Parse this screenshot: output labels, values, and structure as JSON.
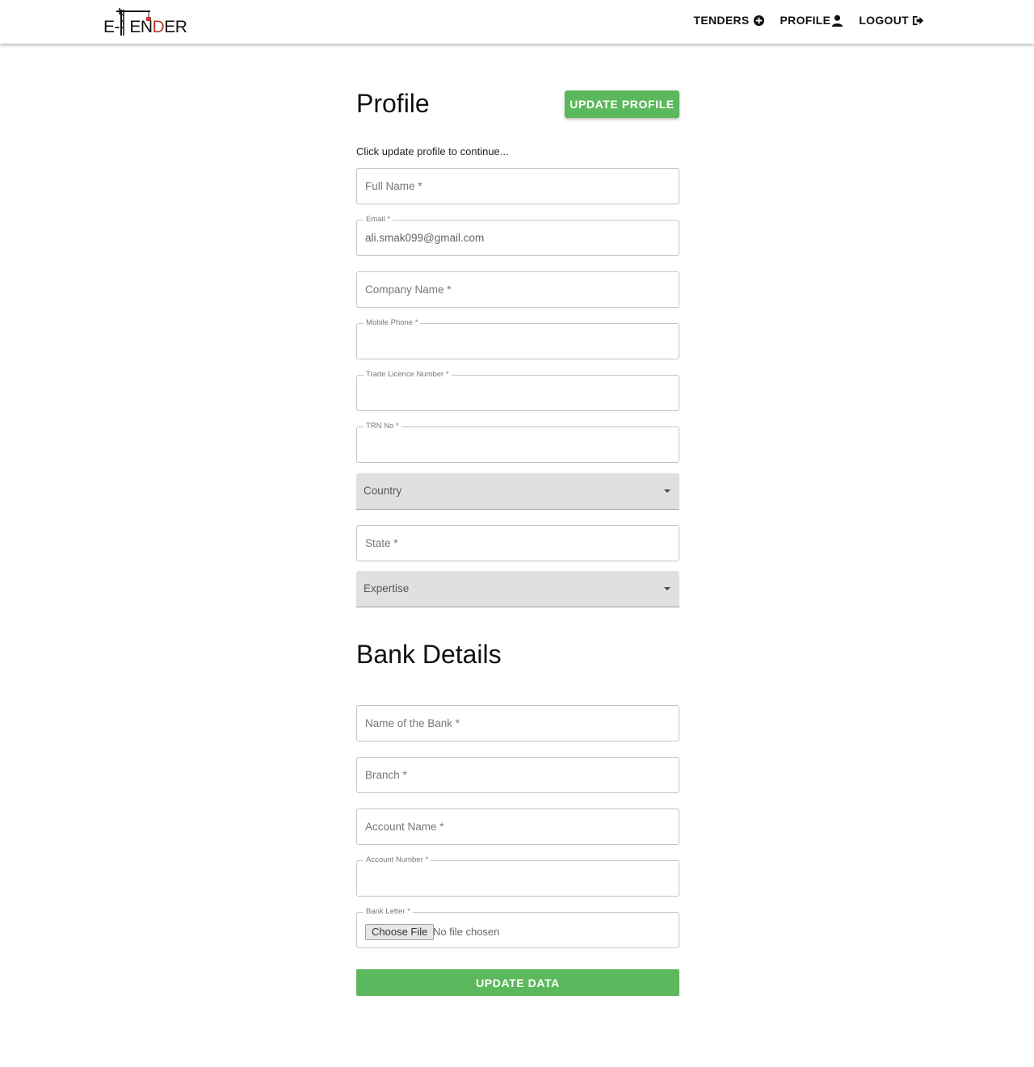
{
  "header": {
    "logo": {
      "prefix": "E-",
      "t": "T",
      "en": "EN",
      "d": "D",
      "er": "ER"
    },
    "nav": {
      "tenders": {
        "label": "TENDERS",
        "icon": "plus-circle-icon"
      },
      "profile": {
        "label": "PROFILE",
        "icon": "user-icon"
      },
      "logout": {
        "label": "LOGOUT",
        "icon": "sign-out-icon"
      }
    }
  },
  "profile": {
    "title": "Profile",
    "update_button": "UPDATE PROFILE",
    "subtitle": "Click update profile to continue...",
    "fields": {
      "full_name": {
        "placeholder": "Full Name *"
      },
      "email": {
        "label": "Email *",
        "value": "ali.smak099@gmail.com"
      },
      "company_name": {
        "placeholder": "Company Name *"
      },
      "mobile_phone": {
        "label": "Mobile Phone *"
      },
      "trade_licence": {
        "label": "Trade Licence Number *"
      },
      "trn_no": {
        "label": "TRN No *"
      },
      "country": {
        "placeholder": "Country"
      },
      "state": {
        "placeholder": "State *"
      },
      "expertise": {
        "placeholder": "Expertise"
      }
    }
  },
  "bank": {
    "title": "Bank Details",
    "fields": {
      "bank_name": {
        "placeholder": "Name of the Bank *"
      },
      "branch": {
        "placeholder": "Branch *"
      },
      "account_name": {
        "placeholder": "Account Name *"
      },
      "account_number": {
        "label": "Account Number *"
      },
      "bank_letter": {
        "label": "Bank Letter *",
        "button": "Choose File",
        "status": "No file chosen"
      }
    },
    "submit": "UPDATE DATA"
  },
  "colors": {
    "accent_green": "#5cb85c",
    "logo_red": "#c0392b"
  }
}
